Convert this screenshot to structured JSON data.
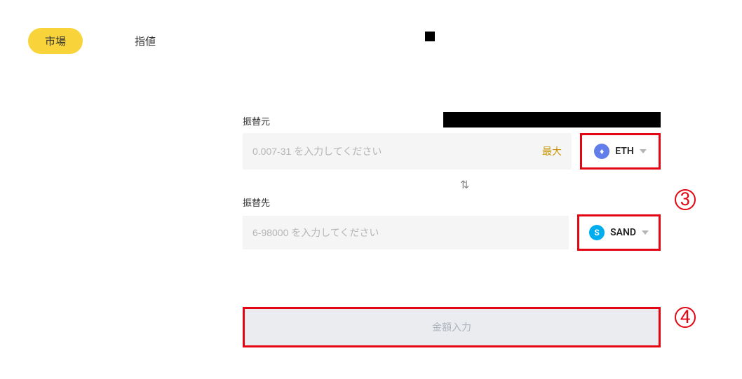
{
  "tabs": {
    "market": "市場",
    "limit": "指値"
  },
  "from": {
    "label": "振替元",
    "placeholder": "0.007-31 を入力してください",
    "max": "最大",
    "currency": "ETH",
    "icon_glyph": "♦",
    "icon_letter": ""
  },
  "to": {
    "label": "振替先",
    "placeholder": "6-98000 を入力してください",
    "currency": "SAND",
    "icon_letter": "S"
  },
  "swap_glyph": "⇅",
  "submit": "金額入力",
  "annotations": {
    "a3": "3",
    "a4": "4"
  }
}
